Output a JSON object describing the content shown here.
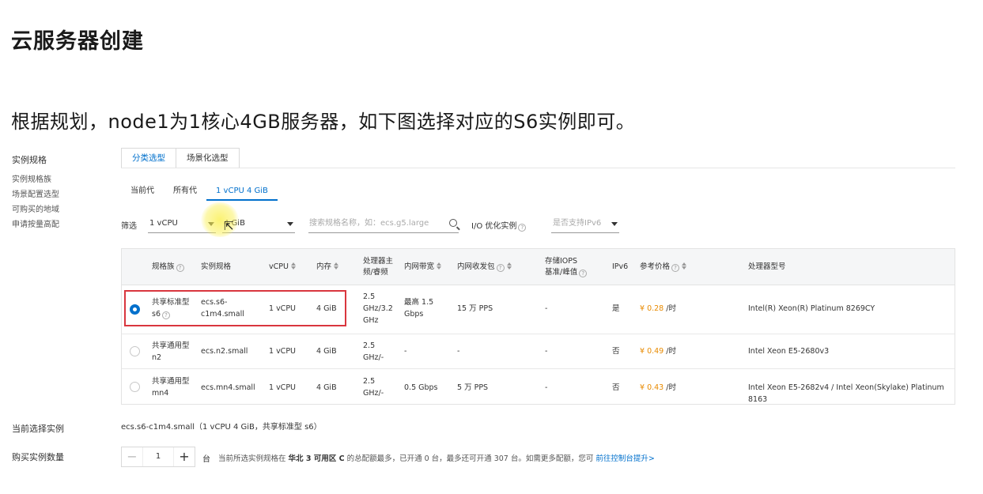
{
  "page": {
    "title": "云服务器创建",
    "intro": "根据规划，node1为1核心4GB服务器，如下图选择对应的S6实例即可。"
  },
  "left_labels": {
    "main": "实例规格",
    "items": [
      "实例规格族",
      "场景配置选型",
      "可购买的地域",
      "申请按量高配"
    ]
  },
  "top_tabs": [
    "分类选型",
    "场景化选型"
  ],
  "sub_tabs": [
    "当前代",
    "所有代",
    "1 vCPU 4 GiB"
  ],
  "filter": {
    "label": "筛选",
    "vcpu_value": "1 vCPU",
    "memory_value": "4 GiB",
    "search_placeholder": "搜索规格名称，如：ecs.g5.large",
    "io_label": "I/O 优化实例",
    "ipv6_placeholder": "是否支持IPv6"
  },
  "table": {
    "headers": {
      "family": "规格族",
      "spec": "实例规格",
      "vcpu": "vCPU",
      "memory": "内存",
      "freq_line1": "处理器主",
      "freq_line2": "频/睿频",
      "bandwidth": "内网带宽",
      "pps": "内网收发包",
      "iops_line1": "存储IOPS",
      "iops_line2": "基准/峰值",
      "ipv6": "IPv6",
      "price": "参考价格",
      "cpu_model": "处理器型号"
    },
    "rows": [
      {
        "family_line1": "共享标准型",
        "family_line2": "s6",
        "spec_line1": "ecs.s6-",
        "spec_line2": "c1m4.small",
        "vcpu": "1 vCPU",
        "memory": "4 GiB",
        "freq_line1": "2.5",
        "freq_line2": "GHz/3.2",
        "freq_line3": "GHz",
        "bandwidth_line1": "最高 1.5",
        "bandwidth_line2": "Gbps",
        "pps": "15 万 PPS",
        "iops": "-",
        "ipv6": "是",
        "price": "¥ 0.28",
        "price_unit": "/时",
        "cpu_model": "Intel(R) Xeon(R) Platinum 8269CY",
        "selected": true
      },
      {
        "family_line1": "共享通用型",
        "family_line2": "n2",
        "spec_line1": "ecs.n2.small",
        "spec_line2": "",
        "vcpu": "1 vCPU",
        "memory": "4 GiB",
        "freq_line1": "2.5",
        "freq_line2": "GHz/-",
        "freq_line3": "",
        "bandwidth_line1": "-",
        "bandwidth_line2": "",
        "pps": "-",
        "iops": "-",
        "ipv6": "否",
        "price": "¥ 0.49",
        "price_unit": "/时",
        "cpu_model": "Intel Xeon E5-2680v3",
        "selected": false
      },
      {
        "family_line1": "共享通用型",
        "family_line2": "mn4",
        "spec_line1": "ecs.mn4.small",
        "spec_line2": "",
        "vcpu": "1 vCPU",
        "memory": "4 GiB",
        "freq_line1": "2.5",
        "freq_line2": "GHz/-",
        "freq_line3": "",
        "bandwidth_line1": "0.5 Gbps",
        "bandwidth_line2": "",
        "pps": "5 万 PPS",
        "iops": "-",
        "ipv6": "否",
        "price": "¥ 0.43",
        "price_unit": "/时",
        "cpu_model": "Intel Xeon E5-2682v4 / Intel Xeon(Skylake) Platinum 8163",
        "selected": false
      }
    ]
  },
  "current": {
    "label": "当前选择实例",
    "value": "ecs.s6-c1m4.small（1 vCPU 4 GiB，共享标准型 s6）"
  },
  "quantity": {
    "label": "购买实例数量",
    "value": "1",
    "minus": "−",
    "plus": "+",
    "unit": "台",
    "note_prefix": "当前所选实例规格在",
    "note_region": "华北 3 可用区 C",
    "note_suffix": "的总配额最多，已开通 0 台，最多还可开通 307 台。如需更多配额，您可",
    "note_link": "前往控制台提升>"
  },
  "colors": {
    "accent": "#0070cc",
    "price": "#e88a00",
    "highlight_box": "#d9363e"
  }
}
